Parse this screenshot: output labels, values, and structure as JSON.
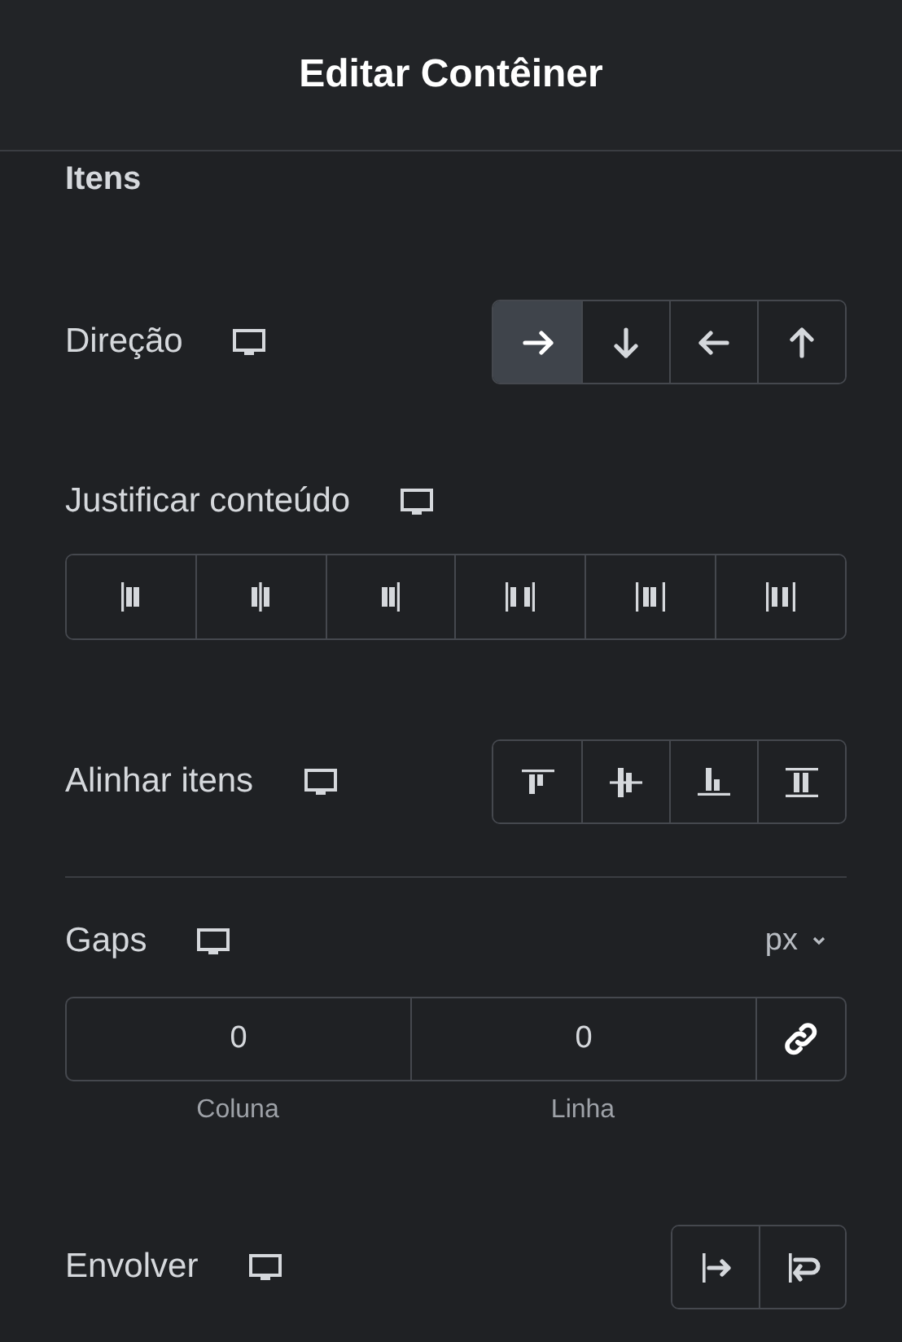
{
  "header": {
    "title": "Editar Contêiner"
  },
  "section": {
    "title": "Itens"
  },
  "controls": [
    {
      "kind": "direction",
      "label": "Direção",
      "responsive": true,
      "options": [
        {
          "selected": true
        },
        {
          "selected": false
        },
        {
          "selected": false
        },
        {
          "selected": false
        }
      ]
    },
    {
      "kind": "justify",
      "label": "Justificar conteúdo",
      "responsive": true,
      "options": [
        {
          "selected": false
        },
        {
          "selected": false
        },
        {
          "selected": false
        },
        {
          "selected": false
        },
        {
          "selected": false
        },
        {
          "selected": false
        }
      ]
    },
    {
      "kind": "align",
      "label": "Alinhar itens",
      "responsive": true,
      "options": [
        {
          "selected": false
        },
        {
          "selected": false
        },
        {
          "selected": false
        },
        {
          "selected": false
        }
      ]
    },
    {
      "kind": "gaps",
      "label": "Gaps",
      "responsive": true,
      "unit": "px",
      "fields": [
        {
          "value": "0",
          "caption": "Coluna"
        },
        {
          "value": "0",
          "caption": "Linha"
        }
      ],
      "linked": true
    },
    {
      "kind": "wrap",
      "label": "Envolver",
      "responsive": true,
      "options": [
        {
          "selected": false
        },
        {
          "selected": false
        }
      ]
    }
  ]
}
